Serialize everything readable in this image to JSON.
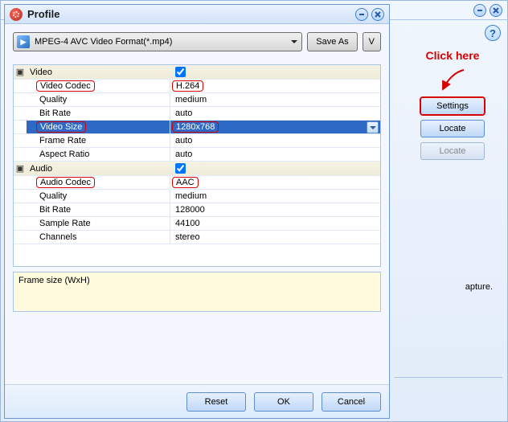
{
  "dialog": {
    "title": "Profile",
    "format_label": "MPEG-4 AVC Video Format(*.mp4)",
    "save_as_label": "Save As",
    "v_label": "V",
    "groups": {
      "video": {
        "label": "Video",
        "checked": true,
        "rows": [
          {
            "label": "Video Codec",
            "value": "H.264",
            "label_red": true,
            "value_red": true
          },
          {
            "label": "Quality",
            "value": "medium"
          },
          {
            "label": "Bit Rate",
            "value": "auto"
          },
          {
            "label": "Video Size",
            "value": "1280x768",
            "label_red": true,
            "value_red": true,
            "selected": true,
            "dropdown": true
          },
          {
            "label": "Frame Rate",
            "value": "auto"
          },
          {
            "label": "Aspect Ratio",
            "value": "auto"
          }
        ]
      },
      "audio": {
        "label": "Audio",
        "checked": true,
        "rows": [
          {
            "label": "Audio Codec",
            "value": "AAC",
            "label_red": true,
            "value_red": true
          },
          {
            "label": "Quality",
            "value": "medium"
          },
          {
            "label": "Bit Rate",
            "value": "128000"
          },
          {
            "label": "Sample Rate",
            "value": "44100"
          },
          {
            "label": "Channels",
            "value": "stereo"
          }
        ]
      }
    },
    "hint": "Frame size (WxH)",
    "footer": {
      "reset": "Reset",
      "ok": "OK",
      "cancel": "Cancel"
    }
  },
  "right_pane": {
    "annotation": "Click here",
    "buttons": [
      {
        "label": "Settings",
        "highlight": true
      },
      {
        "label": "Locate"
      },
      {
        "label": "Locate",
        "disabled": true
      }
    ],
    "stray_text": "apture."
  }
}
